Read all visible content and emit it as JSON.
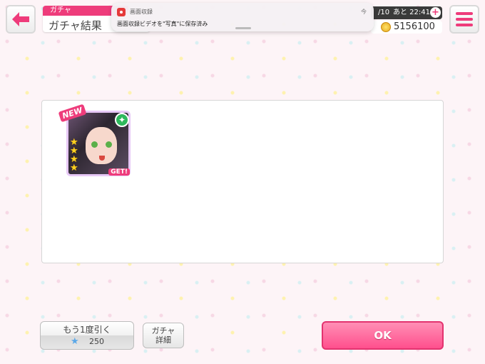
{
  "header": {
    "category_tag": "ガチャ",
    "title": "ガチャ結果",
    "back_icon": "back-arrow-icon",
    "menu_icon": "hamburger-menu-icon"
  },
  "notification": {
    "app_name": "画面収録",
    "time": "今",
    "message": "画面収録ビデオを\"写真\"に保存済み"
  },
  "status": {
    "stamina": "/10",
    "timer": "あと 22:41",
    "coins": "5156100"
  },
  "result": {
    "card": {
      "new_label": "NEW",
      "get_label": "GET!",
      "rarity_stars": 4,
      "attribute_icon": "green-star-attribute-icon"
    }
  },
  "buttons": {
    "again_label": "もう1度引く",
    "again_cost": "250",
    "detail_line1": "ガチャ",
    "detail_line2": "詳細",
    "ok_label": "OK"
  },
  "colors": {
    "accent": "#ee3c7b",
    "ok_button": "#ff5e95",
    "attribute": "#2eb85c"
  }
}
